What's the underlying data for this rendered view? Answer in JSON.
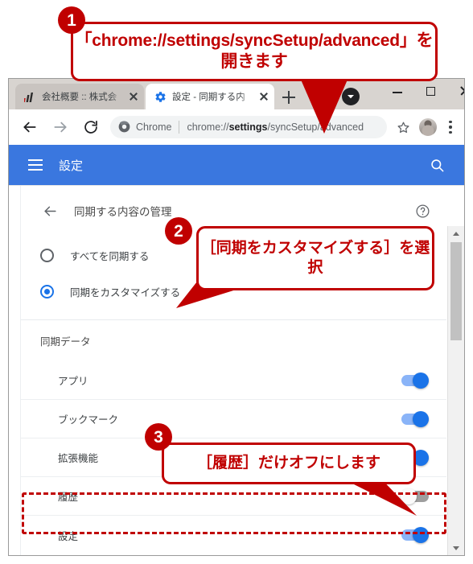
{
  "browser": {
    "tabs": [
      {
        "title": "会社概要 :: 株式会",
        "favicon": "chart-bars-favicon",
        "active": false
      },
      {
        "title": "設定 - 同期する内",
        "favicon": "gear-favicon",
        "active": true
      }
    ],
    "new_tab_label": "+",
    "window_controls": {
      "minimize": "–",
      "maximize": "□",
      "close": "×"
    },
    "omnibox": {
      "scheme_label": "Chrome",
      "url_prefix": "chrome://",
      "url_bold": "settings",
      "url_suffix": "/syncSetup/advanced",
      "url_full": "chrome://settings/syncSetup/advanced"
    }
  },
  "settings": {
    "appbar_title": "設定",
    "subpage_title": "同期する内容の管理",
    "sync_modes": [
      {
        "label": "すべてを同期する",
        "selected": false
      },
      {
        "label": "同期をカスタマイズする",
        "selected": true
      }
    ],
    "section_title": "同期データ",
    "data_items": [
      {
        "label": "アプリ",
        "on": true
      },
      {
        "label": "ブックマーク",
        "on": true
      },
      {
        "label": "拡張機能",
        "on": true
      },
      {
        "label": "履歴",
        "on": false
      },
      {
        "label": "設定",
        "on": true
      }
    ]
  },
  "annotations": {
    "callout_1": {
      "number": "1",
      "text": "「chrome://settings/syncSetup/advanced」を開きます"
    },
    "callout_2": {
      "number": "2",
      "text": "［同期をカスタマイズする］を選択"
    },
    "callout_3": {
      "number": "3",
      "text": "［履歴］だけオフにします"
    }
  },
  "colors": {
    "accent_blue": "#1a73e8",
    "appbar_blue": "#3a77df",
    "annotation_red": "#c00000",
    "toggle_on_track": "#8ab4f8",
    "toggle_off_track": "#9e9e9e"
  }
}
